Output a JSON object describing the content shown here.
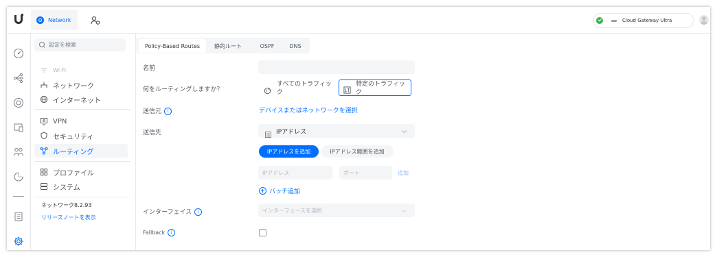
{
  "header": {
    "app_tab_label": "Network",
    "gateway_label": "Cloud Gateway Ultra"
  },
  "sidebar": {
    "search_placeholder": "設定を検索",
    "items": [
      {
        "label": "Wi-Fi",
        "icon": "wifi-icon"
      },
      {
        "label": "ネットワーク",
        "icon": "network-icon"
      },
      {
        "label": "インターネット",
        "icon": "globe-icon"
      },
      {
        "label": "VPN",
        "icon": "vpn-icon"
      },
      {
        "label": "セキュリティ",
        "icon": "shield-icon"
      },
      {
        "label": "ルーティング",
        "icon": "routing-icon",
        "active": true
      },
      {
        "label": "プロファイル",
        "icon": "profile-icon"
      },
      {
        "label": "システム",
        "icon": "system-icon"
      }
    ],
    "version": "ネットワーク8.2.93",
    "release_notes": "リリースノートを表示"
  },
  "tabs": [
    {
      "label": "Policy-Based Routes",
      "active": true
    },
    {
      "label": "静的ルート"
    },
    {
      "label": "OSPF"
    },
    {
      "label": "DNS"
    }
  ],
  "form": {
    "name_label": "名前",
    "name_value": "",
    "route_what_label": "何をルーティングしますか？",
    "all_traffic_label": "すべてのトラフィック",
    "specific_traffic_label": "特定のトラフィック",
    "source_label": "送信元",
    "source_link": "デバイスまたはネットワークを選択",
    "destination_label": "送信先",
    "destination_select": "IPアドレス",
    "add_ip_button": "IPアドレスを追加",
    "add_ip_range_button": "IPアドレス範囲を追加",
    "ip_placeholder": "IPアドレス",
    "port_placeholder": "ポート",
    "add_link": "追加",
    "batch_add": "バッチ追加",
    "interface_label": "インターフェイス",
    "interface_placeholder": "インターフェースを選択",
    "fallback_label": "Fallback"
  },
  "colors": {
    "accent": "#006fff",
    "active_bg": "#f4f5f6",
    "border": "#e6e8eb",
    "status_green": "#39b54a"
  }
}
